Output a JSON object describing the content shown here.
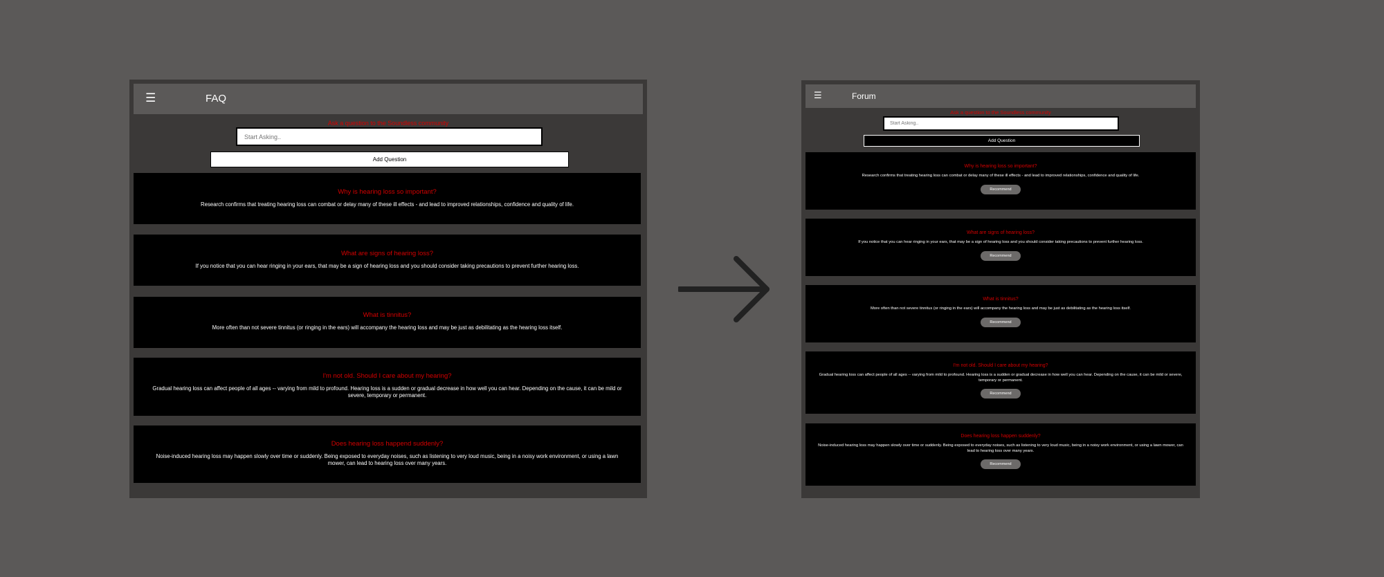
{
  "faq": {
    "menu_icon": "☰",
    "title": "FAQ",
    "prompt": "Ask a question to the Soundless community",
    "input_placeholder": "Start Asking..",
    "add_button": "Add Question",
    "cards": [
      {
        "q": "Why is hearing loss so important?",
        "a": "Research confirms that treating hearing loss can combat or delay many of these ill effects - and lead to improved relationships, confidence and quality of life."
      },
      {
        "q": "What are signs of hearing loss?",
        "a": "If you notice that you can hear ringing in your ears, that may be a sign of hearing loss and you should consider taking precautions to prevent further hearing loss."
      },
      {
        "q": "What is tinnitus?",
        "a": "More often than not severe tinnitus (or ringing in the ears) will accompany the hearing loss and may be just as debilitating as the hearing loss itself."
      },
      {
        "q": "I'm not old. Should I care about my hearing?",
        "a": "Gradual hearing loss can affect people of all ages -- varying from mild to profound. Hearing loss is a sudden or gradual decrease in how well you can hear. Depending on the cause, it can be mild or severe, temporary or permanent."
      },
      {
        "q": "Does hearing loss happend suddenly?",
        "a": "Noise-induced hearing loss may happen slowly over time or suddenly. Being exposed to everyday noises, such as listening to very loud music, being in a noisy work environment, or using a lawn mower, can lead to hearing loss over many years."
      }
    ]
  },
  "forum": {
    "menu_icon": "☰",
    "title": "Forum",
    "prompt": "Ask a question to the Soundless community",
    "input_placeholder": "Start Asking..",
    "add_button": "Add Question",
    "recommend_label": "Recommend",
    "cards": [
      {
        "q": "Why is hearing loss so important?",
        "a": "Research confirms that treating hearing loss can combat or delay many of these ill effects - and lead to improved relationships, confidence and quality of life."
      },
      {
        "q": "What are signs of hearing loss?",
        "a": "If you notice that you can hear ringing in your ears, that may be a sign of hearing loss and you should consider taking precautions to prevent further hearing loss."
      },
      {
        "q": "What is tinnitus?",
        "a": "More often than not severe tinnitus (or ringing in the ears) will accompany the hearing loss and may be just as debilitating as the hearing loss itself."
      },
      {
        "q": "I'm not old. Should I care about my hearing?",
        "a": "Gradual hearing loss can affect people of all ages -- varying from mild to profound. Hearing loss is a sudden or gradual decrease in how well you can hear. Depending on the cause, it can be mild or severe, temporary or permanent."
      },
      {
        "q": "Does hearing loss happen suddenly?",
        "a": "Noise-induced hearing loss may happen slowly over time or suddenly. Being exposed to everyday noises, such as listening to very loud music, being in a noisy work environment, or using a lawn mower, can lead to hearing loss over many years."
      }
    ]
  },
  "colors": {
    "background": "#5b5958",
    "frame": "#3b3938",
    "card": "#000000",
    "accent_red": "#d40000"
  },
  "icons": [
    "hamburger-menu-icon",
    "right-arrow-icon"
  ]
}
